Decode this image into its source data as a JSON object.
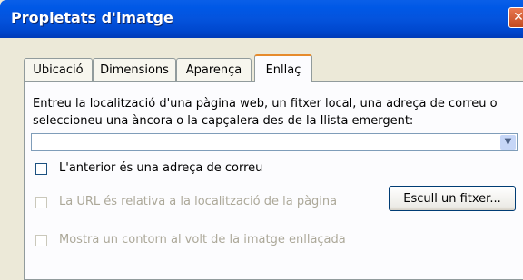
{
  "window": {
    "title": "Propietats d'imatge",
    "close_icon": "close-icon"
  },
  "tabs": [
    {
      "label": "Ubicació",
      "active": false
    },
    {
      "label": "Dimensions",
      "active": false
    },
    {
      "label": "Aparença",
      "active": false
    },
    {
      "label": "Enllaç",
      "active": true
    }
  ],
  "link": {
    "instructions": "Entreu la localització d'una pàgina web, un fitxer local, una adreça de correu o seleccioneu una àncora o la capçalera des de la llista emergent:",
    "url_value": "",
    "email_checkbox": {
      "label": "L'anterior és una adreça de correu",
      "checked": false,
      "enabled": true
    },
    "relative_checkbox": {
      "label": "La URL és relativa a la localització de la pàgina",
      "checked": false,
      "enabled": false
    },
    "browse_button": "Escull un fitxer...",
    "border_checkbox": {
      "label": "Mostra un contorn al volt de la imatge enllaçada",
      "checked": false,
      "enabled": false
    }
  }
}
